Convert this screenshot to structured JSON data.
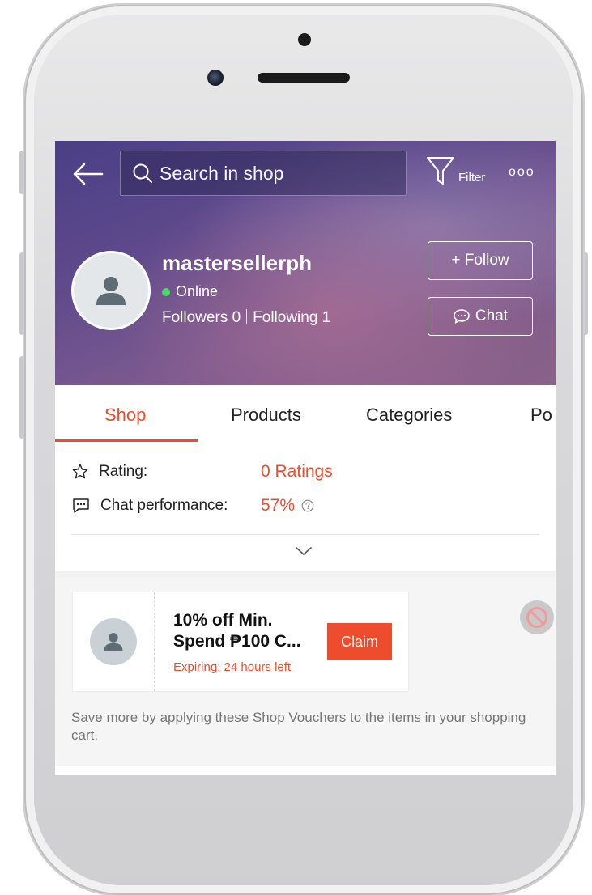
{
  "header": {
    "search_placeholder": "Search in shop",
    "filter_label": "Filter",
    "more_label": "ooo"
  },
  "shop": {
    "name": "mastersellerph",
    "status": "Online",
    "followers_text": "Followers 0",
    "following_text": "Following 1",
    "follow_button": "+ Follow",
    "chat_button": "Chat"
  },
  "tabs": [
    {
      "label": "Shop"
    },
    {
      "label": "Products"
    },
    {
      "label": "Categories"
    },
    {
      "label": "Po"
    }
  ],
  "stats": {
    "rating_label": "Rating:",
    "rating_value": "0 Ratings",
    "chat_label": "Chat performance:",
    "chat_value": "57%"
  },
  "voucher": {
    "title": "10% off Min. Spend ₱100 C...",
    "expiry": "Expiring: 24 hours left",
    "claim_label": "Claim",
    "note": "Save more by applying these Shop Vouchers to the items in your shopping cart."
  },
  "colors": {
    "accent": "#ee4d2d",
    "online": "#4cd964"
  }
}
